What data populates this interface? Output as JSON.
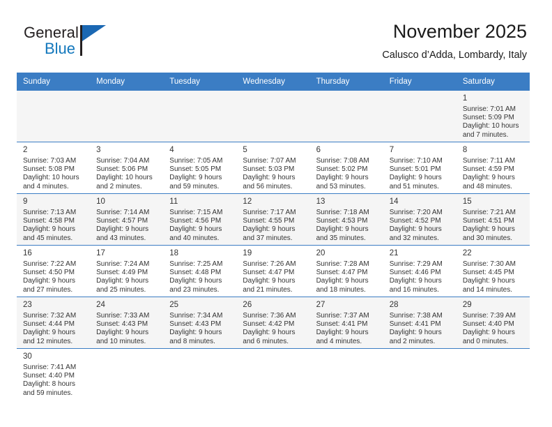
{
  "brand": {
    "name_top": "General",
    "name_bottom": "Blue",
    "color_dark": "#231f20",
    "color_blue": "#1277bc",
    "triangle_color": "#1b68b3"
  },
  "header": {
    "title": "November 2025",
    "subtitle": "Calusco d’Adda, Lombardy, Italy"
  },
  "theme": {
    "header_row_bg": "#3b7dc4",
    "header_row_text": "#ffffff",
    "alt_row_bg": "#f5f5f5",
    "grid_line": "#3b7dc4"
  },
  "calendar": {
    "weekday_headers": [
      "Sunday",
      "Monday",
      "Tuesday",
      "Wednesday",
      "Thursday",
      "Friday",
      "Saturday"
    ],
    "weeks": [
      [
        {
          "day": "",
          "detail": "",
          "empty": true
        },
        {
          "day": "",
          "detail": "",
          "empty": true
        },
        {
          "day": "",
          "detail": "",
          "empty": true
        },
        {
          "day": "",
          "detail": "",
          "empty": true
        },
        {
          "day": "",
          "detail": "",
          "empty": true
        },
        {
          "day": "",
          "detail": "",
          "empty": true
        },
        {
          "day": "1",
          "detail": "Sunrise: 7:01 AM\nSunset: 5:09 PM\nDaylight: 10 hours\nand 7 minutes.",
          "empty": false
        }
      ],
      [
        {
          "day": "2",
          "detail": "Sunrise: 7:03 AM\nSunset: 5:08 PM\nDaylight: 10 hours\nand 4 minutes.",
          "empty": false
        },
        {
          "day": "3",
          "detail": "Sunrise: 7:04 AM\nSunset: 5:06 PM\nDaylight: 10 hours\nand 2 minutes.",
          "empty": false
        },
        {
          "day": "4",
          "detail": "Sunrise: 7:05 AM\nSunset: 5:05 PM\nDaylight: 9 hours\nand 59 minutes.",
          "empty": false
        },
        {
          "day": "5",
          "detail": "Sunrise: 7:07 AM\nSunset: 5:03 PM\nDaylight: 9 hours\nand 56 minutes.",
          "empty": false
        },
        {
          "day": "6",
          "detail": "Sunrise: 7:08 AM\nSunset: 5:02 PM\nDaylight: 9 hours\nand 53 minutes.",
          "empty": false
        },
        {
          "day": "7",
          "detail": "Sunrise: 7:10 AM\nSunset: 5:01 PM\nDaylight: 9 hours\nand 51 minutes.",
          "empty": false
        },
        {
          "day": "8",
          "detail": "Sunrise: 7:11 AM\nSunset: 4:59 PM\nDaylight: 9 hours\nand 48 minutes.",
          "empty": false
        }
      ],
      [
        {
          "day": "9",
          "detail": "Sunrise: 7:13 AM\nSunset: 4:58 PM\nDaylight: 9 hours\nand 45 minutes.",
          "empty": false
        },
        {
          "day": "10",
          "detail": "Sunrise: 7:14 AM\nSunset: 4:57 PM\nDaylight: 9 hours\nand 43 minutes.",
          "empty": false
        },
        {
          "day": "11",
          "detail": "Sunrise: 7:15 AM\nSunset: 4:56 PM\nDaylight: 9 hours\nand 40 minutes.",
          "empty": false
        },
        {
          "day": "12",
          "detail": "Sunrise: 7:17 AM\nSunset: 4:55 PM\nDaylight: 9 hours\nand 37 minutes.",
          "empty": false
        },
        {
          "day": "13",
          "detail": "Sunrise: 7:18 AM\nSunset: 4:53 PM\nDaylight: 9 hours\nand 35 minutes.",
          "empty": false
        },
        {
          "day": "14",
          "detail": "Sunrise: 7:20 AM\nSunset: 4:52 PM\nDaylight: 9 hours\nand 32 minutes.",
          "empty": false
        },
        {
          "day": "15",
          "detail": "Sunrise: 7:21 AM\nSunset: 4:51 PM\nDaylight: 9 hours\nand 30 minutes.",
          "empty": false
        }
      ],
      [
        {
          "day": "16",
          "detail": "Sunrise: 7:22 AM\nSunset: 4:50 PM\nDaylight: 9 hours\nand 27 minutes.",
          "empty": false
        },
        {
          "day": "17",
          "detail": "Sunrise: 7:24 AM\nSunset: 4:49 PM\nDaylight: 9 hours\nand 25 minutes.",
          "empty": false
        },
        {
          "day": "18",
          "detail": "Sunrise: 7:25 AM\nSunset: 4:48 PM\nDaylight: 9 hours\nand 23 minutes.",
          "empty": false
        },
        {
          "day": "19",
          "detail": "Sunrise: 7:26 AM\nSunset: 4:47 PM\nDaylight: 9 hours\nand 21 minutes.",
          "empty": false
        },
        {
          "day": "20",
          "detail": "Sunrise: 7:28 AM\nSunset: 4:47 PM\nDaylight: 9 hours\nand 18 minutes.",
          "empty": false
        },
        {
          "day": "21",
          "detail": "Sunrise: 7:29 AM\nSunset: 4:46 PM\nDaylight: 9 hours\nand 16 minutes.",
          "empty": false
        },
        {
          "day": "22",
          "detail": "Sunrise: 7:30 AM\nSunset: 4:45 PM\nDaylight: 9 hours\nand 14 minutes.",
          "empty": false
        }
      ],
      [
        {
          "day": "23",
          "detail": "Sunrise: 7:32 AM\nSunset: 4:44 PM\nDaylight: 9 hours\nand 12 minutes.",
          "empty": false
        },
        {
          "day": "24",
          "detail": "Sunrise: 7:33 AM\nSunset: 4:43 PM\nDaylight: 9 hours\nand 10 minutes.",
          "empty": false
        },
        {
          "day": "25",
          "detail": "Sunrise: 7:34 AM\nSunset: 4:43 PM\nDaylight: 9 hours\nand 8 minutes.",
          "empty": false
        },
        {
          "day": "26",
          "detail": "Sunrise: 7:36 AM\nSunset: 4:42 PM\nDaylight: 9 hours\nand 6 minutes.",
          "empty": false
        },
        {
          "day": "27",
          "detail": "Sunrise: 7:37 AM\nSunset: 4:41 PM\nDaylight: 9 hours\nand 4 minutes.",
          "empty": false
        },
        {
          "day": "28",
          "detail": "Sunrise: 7:38 AM\nSunset: 4:41 PM\nDaylight: 9 hours\nand 2 minutes.",
          "empty": false
        },
        {
          "day": "29",
          "detail": "Sunrise: 7:39 AM\nSunset: 4:40 PM\nDaylight: 9 hours\nand 0 minutes.",
          "empty": false
        }
      ],
      [
        {
          "day": "30",
          "detail": "Sunrise: 7:41 AM\nSunset: 4:40 PM\nDaylight: 8 hours\nand 59 minutes.",
          "empty": false
        },
        {
          "day": "",
          "detail": "",
          "empty": true
        },
        {
          "day": "",
          "detail": "",
          "empty": true
        },
        {
          "day": "",
          "detail": "",
          "empty": true
        },
        {
          "day": "",
          "detail": "",
          "empty": true
        },
        {
          "day": "",
          "detail": "",
          "empty": true
        },
        {
          "day": "",
          "detail": "",
          "empty": true
        }
      ]
    ]
  }
}
